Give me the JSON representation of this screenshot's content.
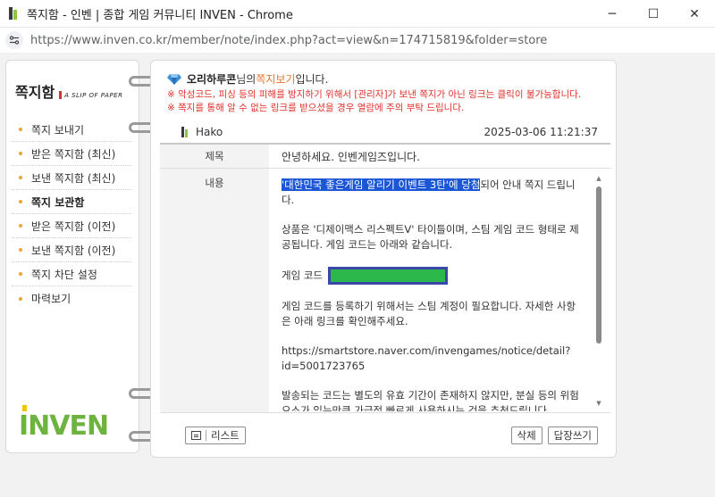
{
  "window": {
    "title": "쪽지함 - 인벤 | 종합 게임 커뮤니티 INVEN - Chrome",
    "minimize": "─",
    "maximize": "☐",
    "close": "✕"
  },
  "address": {
    "url": "https://www.inven.co.kr/member/note/index.php?act=view&n=174715819&folder=store"
  },
  "sidebar": {
    "title_ko": "쪽지함",
    "title_en": "A SLIP OF PAPER",
    "items": [
      {
        "label": "쪽지 보내기"
      },
      {
        "label": "받은 쪽지함 (최신)"
      },
      {
        "label": "보낸 쪽지함 (최신)"
      },
      {
        "label": "쪽지 보관함"
      },
      {
        "label": "받은 쪽지함 (이전)"
      },
      {
        "label": "보낸 쪽지함 (이전)"
      },
      {
        "label": "쪽지 차단 설정"
      },
      {
        "label": "마력보기"
      }
    ],
    "logo": "INVEN"
  },
  "header": {
    "owner": "오리하루콘",
    "suffix1": "님의 ",
    "link": "쪽지보기",
    "suffix2": "입니다.",
    "warning1": "※ 악성코드, 피싱 등의 피해를 방지하기 위해서 [관리자]가 보낸 쪽지가 아닌 링크는 클릭이 불가능합니다.",
    "warning2": "※ 쪽지를 통해 알 수 없는 링크를 받으셨을 경우 열람에 주의 부탁 드립니다."
  },
  "message": {
    "sender": "Hako",
    "date": "2025-03-06 11:21:37",
    "subject_label": "제목",
    "subject": "안녕하세요. 인벤게임즈입니다.",
    "body_label": "내용",
    "body": {
      "p1_selected": "'대한민국 좋은게임 알리기 이벤트 3탄'에 당첨",
      "p1_rest": "되어 안내 쪽지 드립니다.",
      "p2": "상품은 '디제이맥스 리스펙트V' 타이틀이며, 스팀 게임 코드 형태로 제공됩니다. 게임 코드는 아래와 같습니다.",
      "p3_label": "게임 코드",
      "p4": "게임 코드를 등록하기 위해서는 스팀 계정이 필요합니다. 자세한 사항은 아래 링크를 확인해주세요.",
      "p5": "https://smartstore.naver.com/invengames/notice/detail?id=5001723765",
      "p6": "발송되는 코드는 별도의 유효 기간이 존재하지 않지만, 분실 등의 위험 요소가 있는만큼 가급적 빠르게 사용하시는 것을 추천드립니다."
    }
  },
  "footer": {
    "list_label": "리스트",
    "delete_label": "삭제",
    "reply_label": "답장쓰기"
  },
  "colors": {
    "accent_orange": "#e3742b",
    "warning_red": "#e0302a",
    "selection_blue": "#1a56d6",
    "code_green": "#2db84c",
    "inven_green": "#6db33f"
  }
}
